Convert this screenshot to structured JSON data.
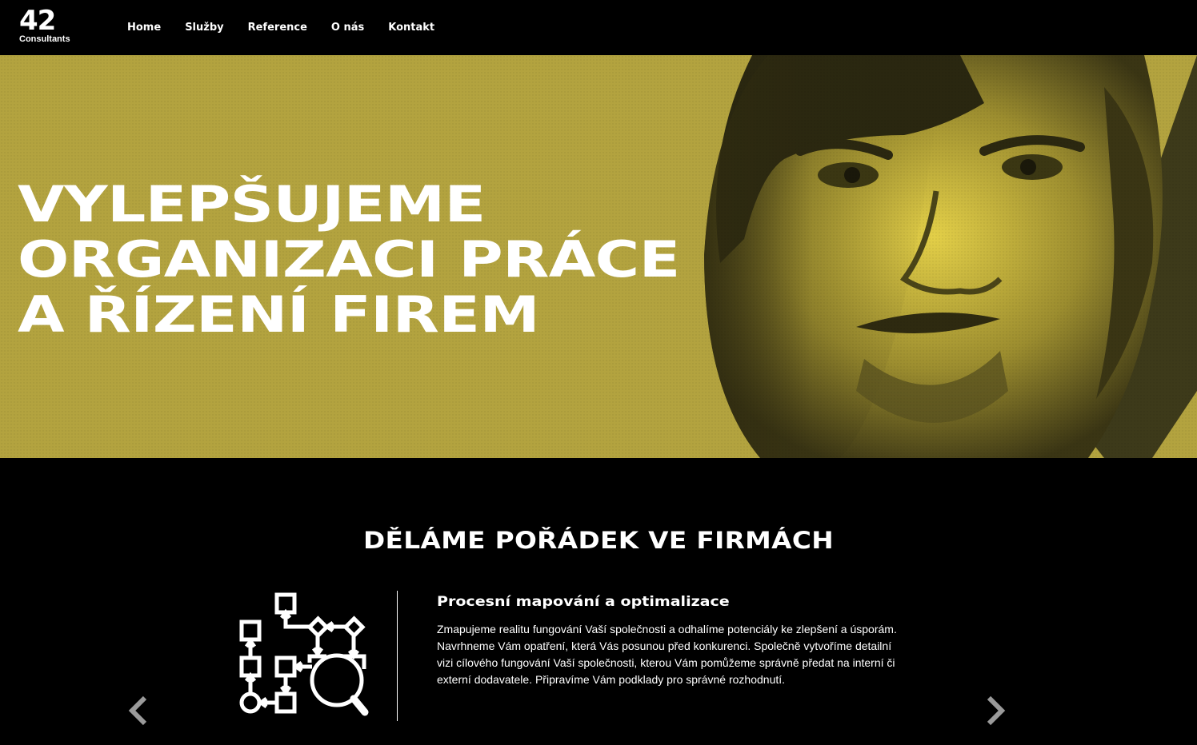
{
  "header": {
    "logo_number": "42",
    "logo_text": "Consultants",
    "nav": [
      "Home",
      "Služby",
      "Reference",
      "O nás",
      "Kontakt"
    ]
  },
  "hero": {
    "title_lines": [
      "VYLEPŠUJEME",
      "ORGANIZACI PRÁCE",
      "A ŘÍZENÍ FIREM"
    ],
    "background_color": "#b3a33f"
  },
  "services": {
    "section_title": "DĚLÁME POŘÁDEK VE FIRMÁCH",
    "current": {
      "icon": "process-map-magnifier-icon",
      "heading": "Procesní mapování a optimalizace",
      "text": "Zmapujeme realitu fungování Vaší společnosti a odhalíme potenciály ke zlepšení a úsporám. Navrhneme Vám opatření, která Vás posunou před konkurenci. Společně vytvoříme detailní vizi cílového fungování Vaší společnosti, kterou Vám pomůžeme správně předat na interní či externí dodavatele. Připravíme Vám podklady pro správné rozhodnutí."
    },
    "prev_icon": "chevron-left-icon",
    "next_icon": "chevron-right-icon"
  }
}
